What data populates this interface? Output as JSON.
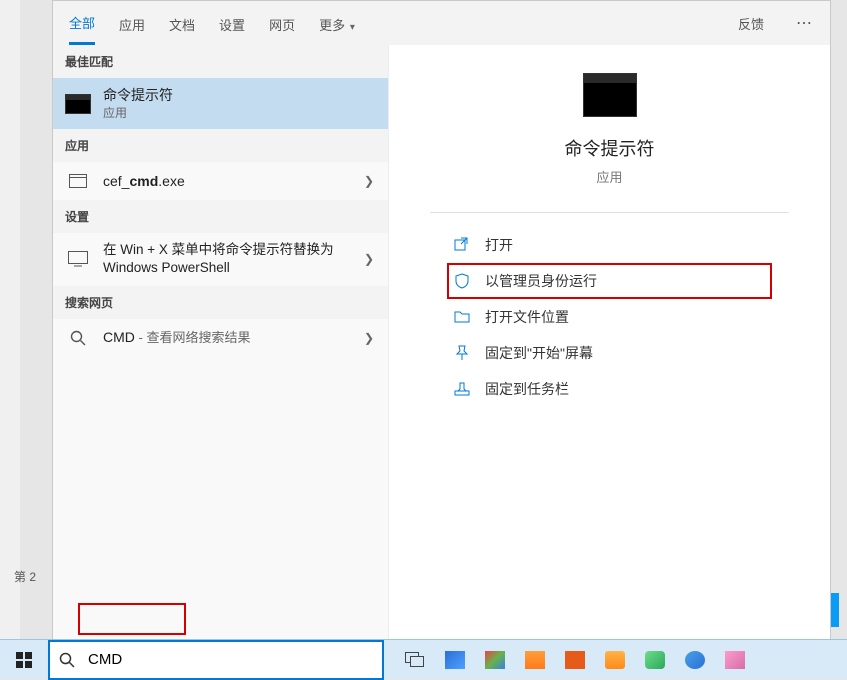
{
  "tabs": {
    "all": "全部",
    "apps": "应用",
    "docs": "文档",
    "settings": "设置",
    "web": "网页",
    "more": "更多",
    "feedback": "反馈"
  },
  "sections": {
    "best_match": "最佳匹配",
    "apps": "应用",
    "settings": "设置",
    "search_web": "搜索网页"
  },
  "results": {
    "cmd": {
      "title": "命令提示符",
      "sub": "应用"
    },
    "cef": {
      "prefix": "cef_",
      "bold": "cmd",
      "suffix": ".exe"
    },
    "setting": {
      "text": "在 Win + X 菜单中将命令提示符替换为 Windows PowerShell"
    },
    "web": {
      "term": "CMD",
      "suffix": " - 查看网络搜索结果"
    }
  },
  "preview": {
    "title": "命令提示符",
    "sub": "应用",
    "actions": {
      "open": "打开",
      "run_admin": "以管理员身份运行",
      "open_loc": "打开文件位置",
      "pin_start": "固定到\"开始\"屏幕",
      "pin_taskbar": "固定到任务栏"
    }
  },
  "search": {
    "value": "CMD"
  },
  "page_num": "第 2",
  "icons": {
    "cmd": "cmd-icon",
    "app": "app-icon",
    "screen": "screen-icon",
    "search": "search-icon",
    "open": "open-icon",
    "shield": "shield-icon",
    "folder": "folder-icon",
    "pin": "pin-icon",
    "taskbar_pin": "taskbar-pin-icon"
  },
  "colors": {
    "accent": "#0078d4",
    "highlight": "#d40000"
  }
}
